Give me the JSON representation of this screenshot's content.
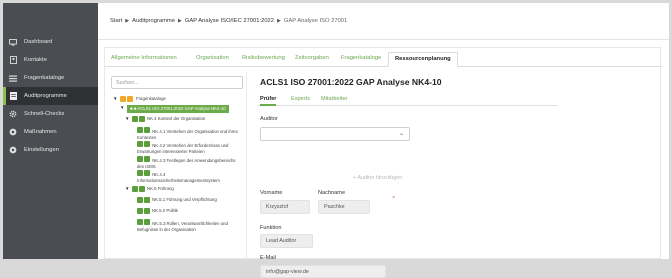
{
  "sidebar": {
    "items": [
      {
        "label": "Dashboard",
        "icon": "monitor-icon"
      },
      {
        "label": "Kontakte",
        "icon": "contacts-icon"
      },
      {
        "label": "Fragenkataloge",
        "icon": "list-icon"
      },
      {
        "label": "Auditprogramme",
        "icon": "document-icon",
        "active": true
      },
      {
        "label": "Schnell-Checks",
        "icon": "gear-icon"
      },
      {
        "label": "Maßnahmen",
        "icon": "globe-icon"
      },
      {
        "label": "Einstellungen",
        "icon": "settings-icon"
      }
    ]
  },
  "breadcrumb": [
    "Start",
    "Auditprogramme",
    "GAP Analyse ISO/IEC 27001:2022",
    "GAP Analyse ISO 27001"
  ],
  "tabs": [
    "Allgemeine Informationen",
    "Organisation",
    "Risikobewertung",
    "Zeitvorgaben",
    "Fragenkataloge",
    "Ressourcenplanung"
  ],
  "active_tab": "Ressourcenplanung",
  "tree": {
    "search_placeholder": "Suchen...",
    "nodes": [
      {
        "text": "Fragenkataloge"
      },
      {
        "text": "ACLS1 ISO 27001:2022 GAP Analyse NK4-10"
      },
      {
        "text": "NK.4 Kontext der Organisation"
      },
      {
        "text": "NK.4.1 Verstehen der Organisation und ihres Kontextes"
      },
      {
        "text": "NK.4.2 Verstehen der Erfordernisse und Erwartungen interessierter Parteien"
      },
      {
        "text": "NK.4.3 Festlegen des Anwendungsbereichs des ISMS"
      },
      {
        "text": "NK.4.4 Informationssicherheitsmanagementsystem"
      },
      {
        "text": "NK.5 Führung"
      },
      {
        "text": "NK.5.1 Führung und Verpflichtung"
      },
      {
        "text": "NK.5.2 Politik"
      },
      {
        "text": "NK.5.3 Rollen, Verantwortlichkeiten und Befugnisse in der Organisation"
      }
    ]
  },
  "detail": {
    "title": "ACLS1 ISO 27001:2022 GAP Analyse NK4-10",
    "subtabs": [
      "Prüfer",
      "Experts",
      "Mitarbeiter"
    ],
    "active_subtab": "Prüfer",
    "auditor_label": "Auditor",
    "add_auditor": "+ Auditor hinzufügen",
    "remove_symbol": "×",
    "vorname_label": "Vorname",
    "nachname_label": "Nachname",
    "vorname": "Krzysztof",
    "nachname": "Paschke",
    "funktion_label": "Funktion",
    "funktion": "Lead Auditor",
    "email_label": "E-Mail",
    "email": "info@gap-view.de"
  },
  "colors": {
    "accent": "#6cab4a",
    "sidebar_bg": "#4a4d51",
    "folder": "#f0a92b"
  }
}
